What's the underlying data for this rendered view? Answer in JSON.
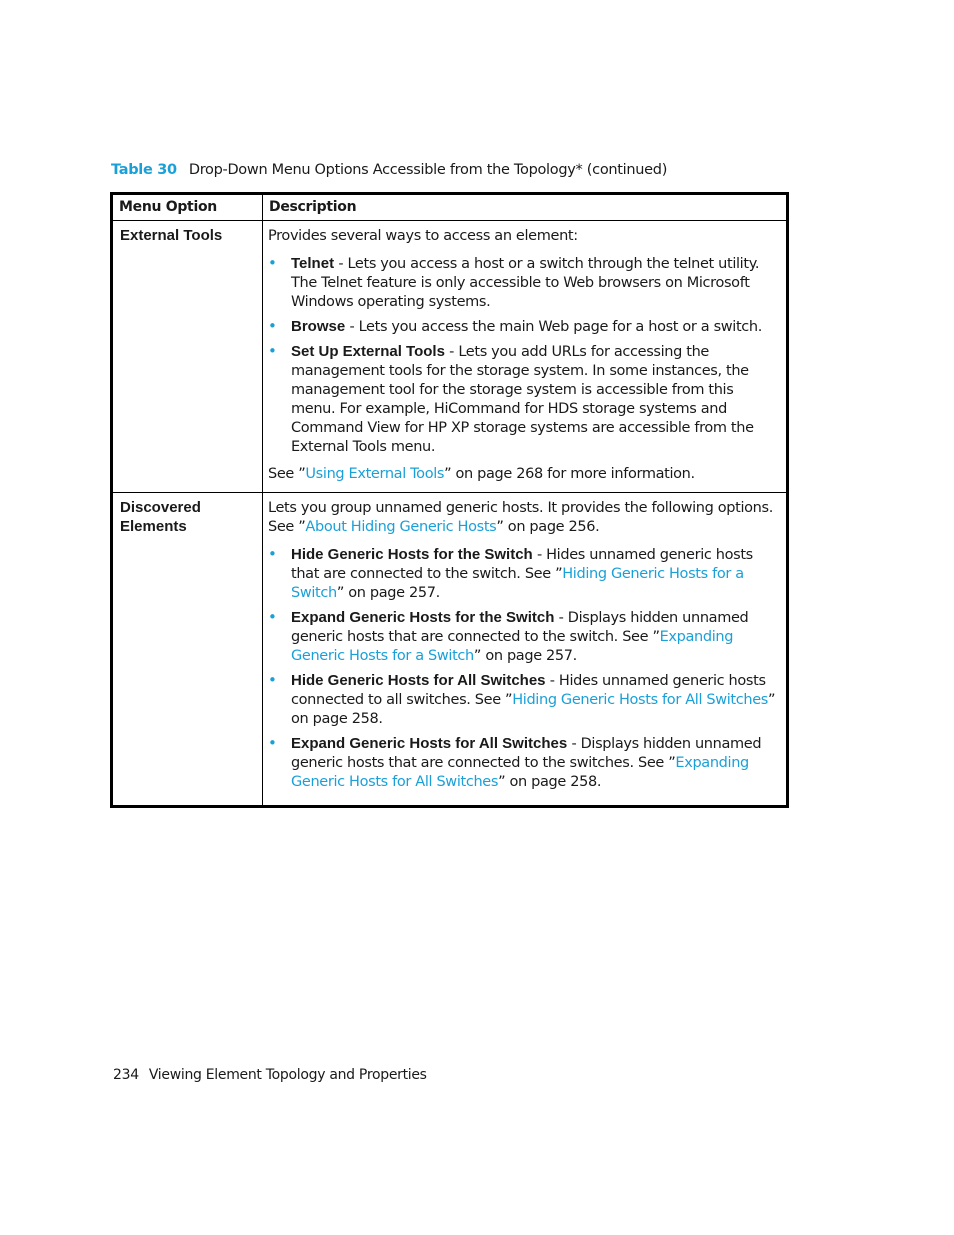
{
  "caption": {
    "number": "Table 30",
    "title": "Drop-Down Menu Options Accessible from the Topology* (continued)"
  },
  "table": {
    "headers": [
      "Menu Option",
      "Description"
    ],
    "rows": [
      {
        "option": "External Tools",
        "intro": {
          "pre": "Provides several ways to access an element:",
          "link": "",
          "post": ""
        },
        "bullets": [
          {
            "term": "Telnet",
            "pre": " - Lets you access a host or a switch through the telnet utility. The Telnet feature is only accessible to Web browsers on Microsoft Windows operating systems.",
            "link": "",
            "post": ""
          },
          {
            "term": "Browse",
            "pre": " - Lets you access the main Web page for a host or a switch.",
            "link": "",
            "post": ""
          },
          {
            "term": "Set Up External Tools",
            "pre": " - Lets you add URLs for accessing the management tools for the storage system. In some instances, the management tool for the storage system is accessible from this menu. For example, HiCommand for HDS storage systems and Command View for HP XP storage systems are accessible from the External Tools menu.",
            "link": "",
            "post": ""
          }
        ],
        "after": {
          "pre": "See ”",
          "link": "Using External Tools",
          "post": "” on page 268 for more information."
        }
      },
      {
        "option": "Discovered Elements",
        "intro": {
          "pre": "Lets you group unnamed generic hosts. It provides the following options. See ”",
          "link": "About Hiding Generic Hosts",
          "post": "” on page 256."
        },
        "bullets": [
          {
            "term": "Hide Generic Hosts for the Switch",
            "pre": " - Hides unnamed generic hosts that are connected to the switch. See ”",
            "link": "Hiding Generic Hosts for a Switch",
            "post": "” on page 257."
          },
          {
            "term": "Expand Generic Hosts for the Switch",
            "pre": " - Displays hidden unnamed generic hosts that are connected to the switch. See ”",
            "link": "Expanding Generic Hosts for a Switch",
            "post": "” on page 257."
          },
          {
            "term": "Hide Generic Hosts for All Switches",
            "pre": " - Hides unnamed generic hosts connected to all switches. See ”",
            "link": "Hiding Generic Hosts for All Switches",
            "post": "” on page 258."
          },
          {
            "term": "Expand Generic Hosts for All Switches",
            "pre": " - Displays hidden unnamed generic hosts that are connected to the switches. See ”",
            "link": "Expanding Generic Hosts for All Switches",
            "post": "” on page 258."
          }
        ],
        "after": null
      }
    ]
  },
  "footer": {
    "page_number": "234",
    "chapter": "Viewing Element Topology and Properties"
  },
  "colors": {
    "accent": "#1aa0d8",
    "text": "#1a1a1a"
  }
}
